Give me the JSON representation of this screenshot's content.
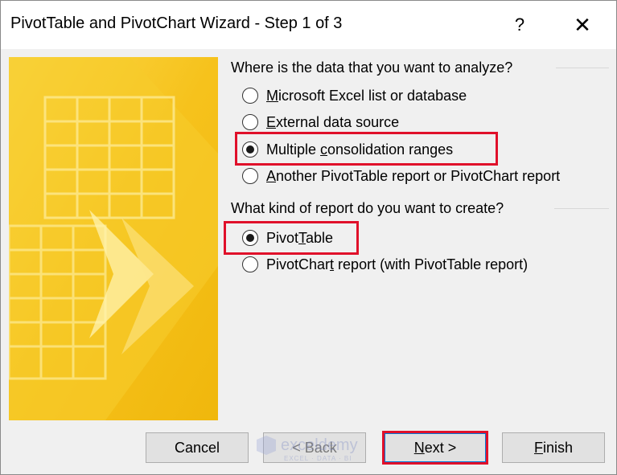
{
  "window": {
    "title": "PivotTable and PivotChart Wizard - Step 1 of 3",
    "help_glyph": "?",
    "close_glyph": "✕"
  },
  "data_source": {
    "label": "Where is the data that you want to analyze?",
    "options": [
      {
        "pre": "",
        "acc": "M",
        "post": "icrosoft Excel list or database",
        "selected": false
      },
      {
        "pre": "",
        "acc": "E",
        "post": "xternal data source",
        "selected": false
      },
      {
        "pre": "Multiple ",
        "acc": "c",
        "post": "onsolidation ranges",
        "selected": true
      },
      {
        "pre": "",
        "acc": "A",
        "post": "nother PivotTable report or PivotChart report",
        "selected": false
      }
    ]
  },
  "report_kind": {
    "label": "What kind of report do you want to create?",
    "options": [
      {
        "pre": "Pivot",
        "acc": "T",
        "post": "able",
        "selected": true
      },
      {
        "pre": "PivotChar",
        "acc": "t",
        "post": " report (with PivotTable report)",
        "selected": false
      }
    ]
  },
  "buttons": {
    "cancel": "Cancel",
    "back": "< Back",
    "next_acc": "N",
    "next_post": "ext >",
    "finish_acc": "F",
    "finish_post": "inish"
  },
  "watermark": {
    "brand": "exceldemy",
    "tagline": "EXCEL · DATA · BI"
  },
  "colors": {
    "highlight": "#e0102a",
    "art_yellow": "#f5c518"
  }
}
